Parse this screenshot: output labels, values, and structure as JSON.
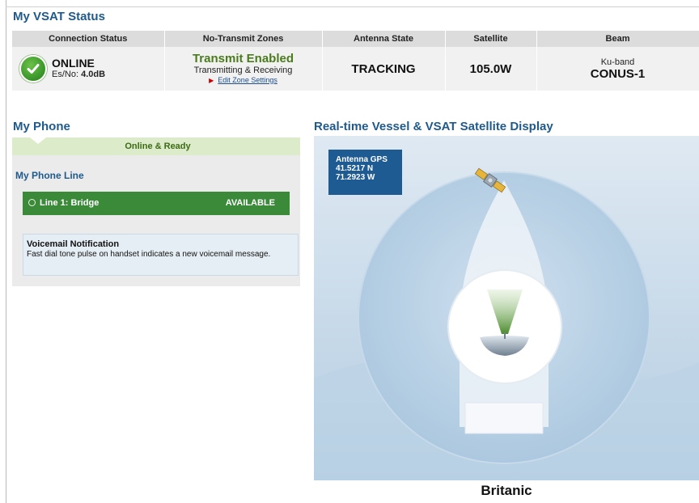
{
  "vsat": {
    "title": "My VSAT Status",
    "headers": [
      "Connection Status",
      "No-Transmit Zones",
      "Antenna State",
      "Satellite",
      "Beam"
    ],
    "connection": {
      "state": "ONLINE",
      "esno_label": "Es/No:",
      "esno_value": "4.0dB",
      "icon": "check-icon"
    },
    "transmit": {
      "title": "Transmit Enabled",
      "subtitle": "Transmitting & Receiving",
      "link": "Edit Zone Settings"
    },
    "antenna_state": "TRACKING",
    "satellite": "105.0W",
    "beam": {
      "band": "Ku-band",
      "name": "CONUS-1"
    }
  },
  "phone": {
    "title": "My Phone",
    "status": "Online & Ready",
    "line_section_title": "My Phone Line",
    "line": {
      "name": "Line 1: Bridge",
      "status": "AVAILABLE"
    },
    "voicemail": {
      "title": "Voicemail Notification",
      "text": "Fast dial tone pulse on handset indicates a new voicemail message."
    }
  },
  "display": {
    "title": "Real-time Vessel & VSAT Satellite Display",
    "gps": {
      "label": "Antenna GPS",
      "lat": "41.5217 N",
      "lon": "71.2923 W"
    },
    "vessel_name": "Britanic"
  },
  "colors": {
    "heading": "#1e5a8c",
    "online_green": "#3b8a3a",
    "transmit_green": "#4a7b1c",
    "gps_box": "#1f5b93"
  }
}
